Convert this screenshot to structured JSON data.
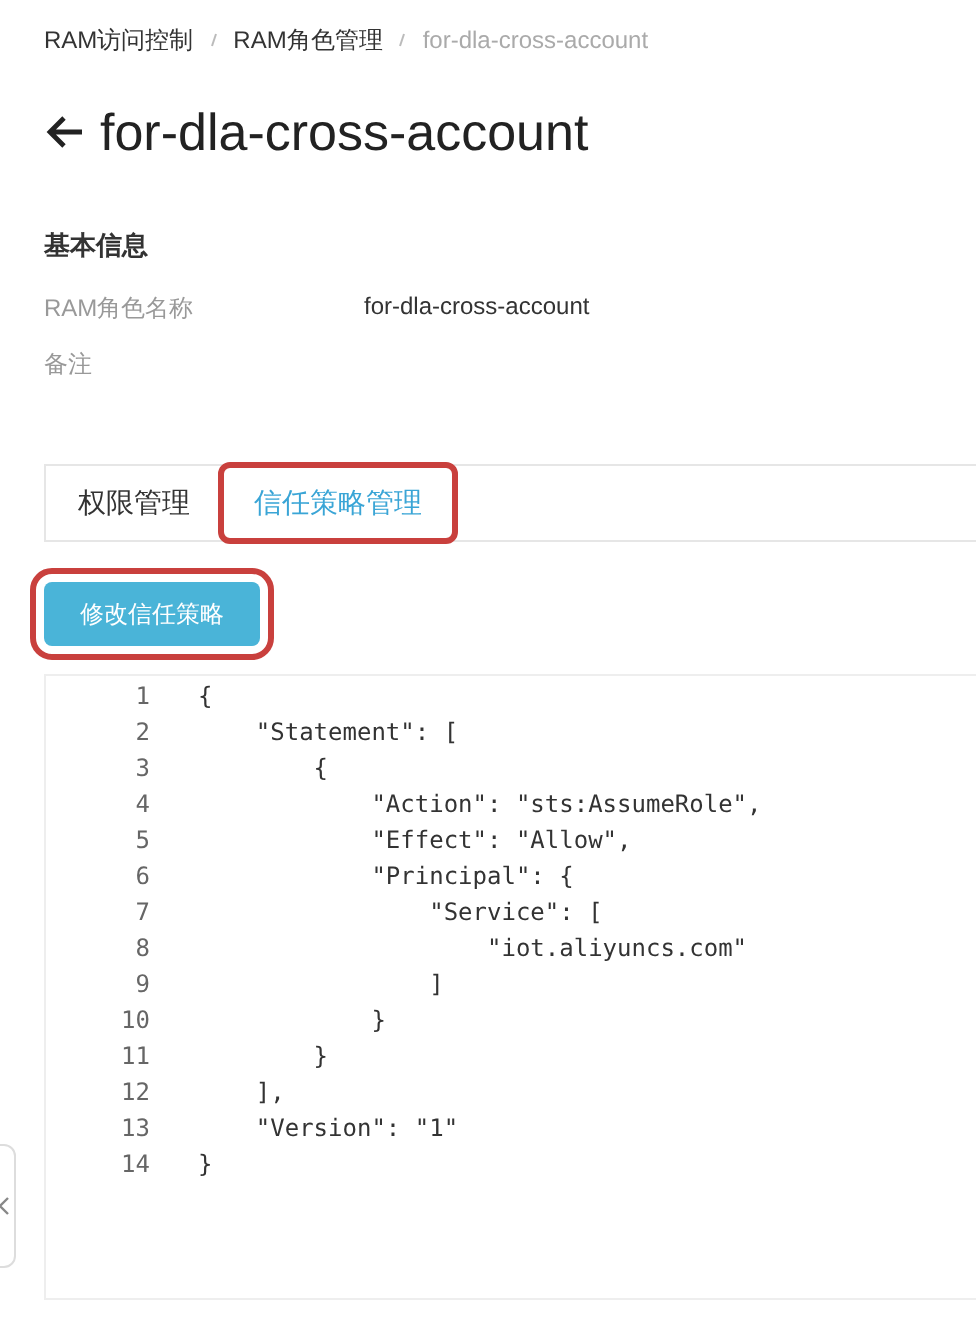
{
  "breadcrumb": [
    {
      "label": "RAM访问控制",
      "current": false
    },
    {
      "label": "RAM角色管理",
      "current": false
    },
    {
      "label": "for-dla-cross-account",
      "current": true
    }
  ],
  "title": "for-dla-cross-account",
  "basic_info": {
    "heading": "基本信息",
    "fields": [
      {
        "label": "RAM角色名称",
        "value": "for-dla-cross-account"
      },
      {
        "label": "备注"
      }
    ]
  },
  "tabs": [
    {
      "label": "权限管理",
      "selected": false,
      "highlighted": false
    },
    {
      "label": "信任策略管理",
      "selected": true,
      "highlighted": true
    }
  ],
  "edit_button": {
    "label": "修改信任策略",
    "highlighted": true
  },
  "code_lines": [
    {
      "number": "1",
      "text": "{"
    },
    {
      "number": "2",
      "text": "    \"Statement\": ["
    },
    {
      "number": "3",
      "text": "        {"
    },
    {
      "number": "4",
      "text": "            \"Action\": \"sts:AssumeRole\","
    },
    {
      "number": "5",
      "text": "            \"Effect\": \"Allow\","
    },
    {
      "number": "6",
      "text": "            \"Principal\": {"
    },
    {
      "number": "7",
      "text": "                \"Service\": ["
    },
    {
      "number": "8",
      "text": "                    \"iot.aliyuncs.com\""
    },
    {
      "number": "9",
      "text": "                ]"
    },
    {
      "number": "10",
      "text": "            }"
    },
    {
      "number": "11",
      "text": "        }"
    },
    {
      "number": "12",
      "text": "    ],"
    },
    {
      "number": "13",
      "text": "    \"Version\": \"1\""
    },
    {
      "number": "14",
      "text": "}"
    }
  ]
}
